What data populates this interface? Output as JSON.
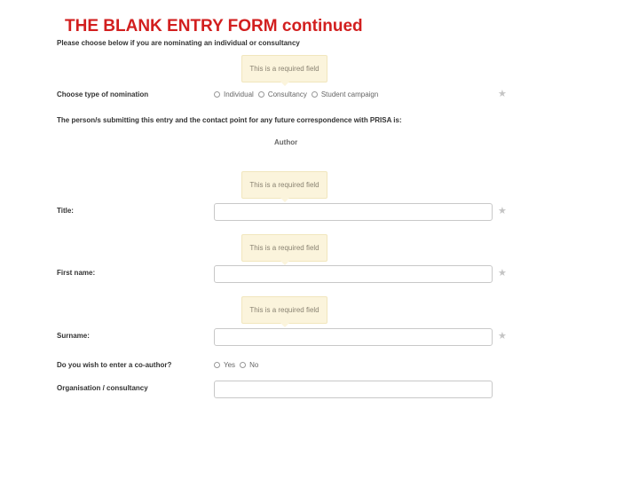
{
  "slide": {
    "title": "THE BLANK ENTRY FORM continued"
  },
  "form": {
    "intro": "Please choose below if you are nominating an individual or consultancy",
    "required_tip": "This is a required field",
    "nomination": {
      "label": "Choose type of nomination",
      "options": [
        "Individual",
        "Consultancy",
        "Student campaign"
      ]
    },
    "submitter_heading": "The person/s submitting this entry and the contact point for any future correspondence with PRISA is:",
    "author_label": "Author",
    "title_label": "Title:",
    "first_name_label": "First name:",
    "surname_label": "Surname:",
    "coauthor": {
      "label": "Do you wish to enter a co-author?",
      "options": [
        "Yes",
        "No"
      ]
    },
    "organisation_label": "Organisation / consultancy",
    "icons": {
      "required": "star-icon",
      "radio": "radio-icon"
    },
    "colors": {
      "title": "#d21f1f",
      "tooltip_bg": "#fbf4dc",
      "star": "#c4c4c4"
    }
  }
}
